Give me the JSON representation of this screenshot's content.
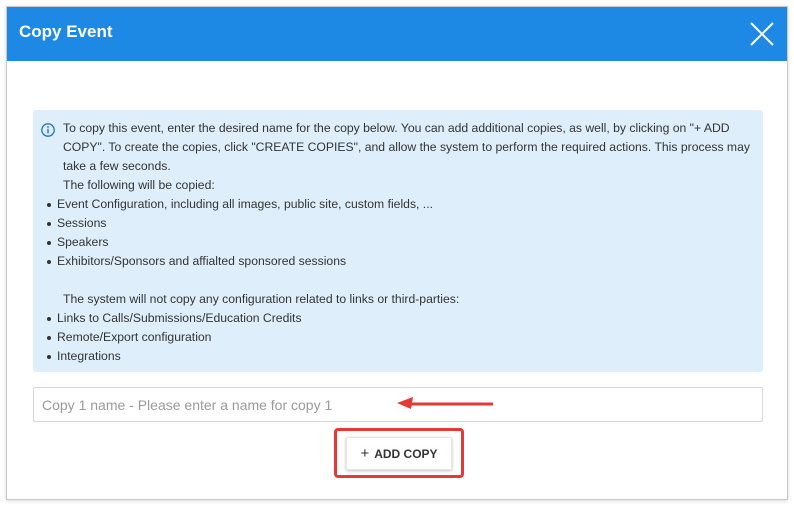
{
  "dialog": {
    "title": "Copy Event"
  },
  "info": {
    "intro": "To copy this event, enter the desired name for the copy below. You can add additional copies, as well, by clicking on \"+ ADD COPY\". To create the copies, click \"CREATE COPIES\", and allow the system to perform the required actions. This process may take a few seconds.",
    "copied_heading": "The following will be copied:",
    "copied_items": [
      "Event Configuration, including all images, public site, custom fields, ...",
      "Sessions",
      "Speakers",
      "Exhibitors/Sponsors and affialted sponsored sessions"
    ],
    "not_copied_heading": "The system will not copy any configuration related to links or third-parties:",
    "not_copied_items": [
      "Links to Calls/Submissions/Education Credits",
      "Remote/Export configuration",
      "Integrations"
    ]
  },
  "copy_input": {
    "placeholder": "Copy 1 name - Please enter a name for copy 1",
    "value": ""
  },
  "add_copy_button": {
    "icon": "+",
    "label": "ADD COPY"
  },
  "colors": {
    "header": "#1e88e5",
    "info_background": "#dfeefb",
    "annotation": "#e53935"
  },
  "icons": {
    "close": "close-icon",
    "info": "info-icon",
    "plus": "plus-icon"
  }
}
